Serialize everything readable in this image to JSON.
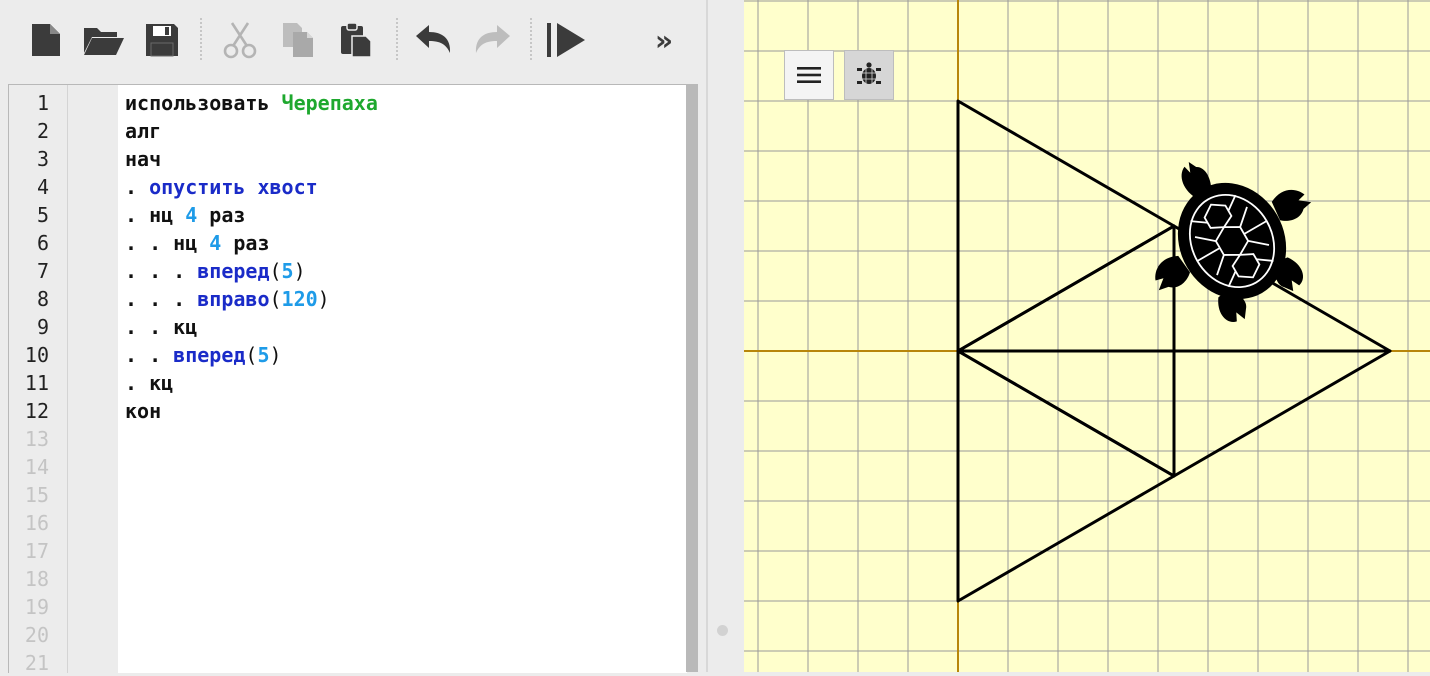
{
  "toolbar": {
    "icons": [
      "new-file-icon",
      "open-folder-icon",
      "save-icon",
      "cut-icon",
      "copy-icon",
      "paste-icon",
      "undo-icon",
      "redo-icon",
      "run-icon",
      "more-icon"
    ],
    "more_label": "»"
  },
  "editor": {
    "line_numbers": [
      "1",
      "2",
      "3",
      "4",
      "5",
      "6",
      "7",
      "8",
      "9",
      "10",
      "11",
      "12",
      "13",
      "14",
      "15",
      "16",
      "17",
      "18",
      "19",
      "20",
      "21"
    ],
    "lines": [
      {
        "kw": "использовать ",
        "grn": "Черепаха"
      },
      {
        "kw": "алг"
      },
      {
        "kw": "нач"
      },
      {
        "kw": ". ",
        "blue": "опустить хвост"
      },
      {
        "kw": ". нц ",
        "num": "4",
        "kw2": " раз"
      },
      {
        "kw": ". . нц ",
        "num": "4",
        "kw2": " раз"
      },
      {
        "kw": ". . . ",
        "blue": "вперед",
        "p1": "(",
        "num": "5",
        "p2": ")"
      },
      {
        "kw": ". . . ",
        "blue": "вправо",
        "p1": "(",
        "num": "120",
        "p2": ")"
      },
      {
        "kw": ". . кц"
      },
      {
        "kw": ". . ",
        "blue": "вперед",
        "p1": "(",
        "num": "5",
        "p2": ")"
      },
      {
        "kw": ". кц"
      },
      {
        "kw": "кон"
      }
    ]
  },
  "canvas": {
    "background": "#ffffcc",
    "grid_color": "#9a9a9a",
    "axis_color": "#b8860b",
    "menu_icon": "menu-icon",
    "turtle_toggle_icon": "turtle-icon"
  }
}
